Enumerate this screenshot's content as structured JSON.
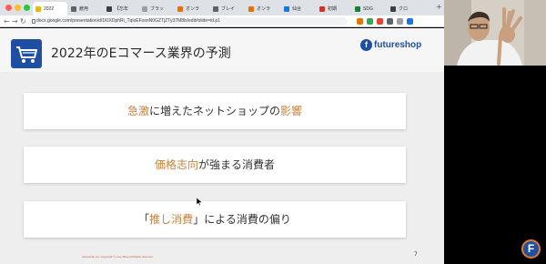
{
  "browser": {
    "tabs": [
      {
        "label": "2022",
        "favicon_color": "#f4b400",
        "active": true
      },
      {
        "label": "雇用",
        "favicon_color": "#5f6368",
        "active": false
      },
      {
        "label": "【忘年",
        "favicon_color": "#3c4043",
        "active": false
      },
      {
        "label": "ブラッ",
        "favicon_color": "#9aa0a6",
        "active": false
      },
      {
        "label": "オンラ",
        "favicon_color": "#e8710a",
        "active": false
      },
      {
        "label": "ブレイ",
        "favicon_color": "#5f6368",
        "active": false
      },
      {
        "label": "オンラ",
        "favicon_color": "#e8710a",
        "active": false
      },
      {
        "label": "仙台",
        "favicon_color": "#1a73e8",
        "active": false
      },
      {
        "label": "初期",
        "favicon_color": "#d93025",
        "active": false
      },
      {
        "label": "SDG",
        "favicon_color": "#188038",
        "active": false
      },
      {
        "label": "クロ",
        "favicon_color": "#3c4043",
        "active": false
      }
    ],
    "new_tab_symbol": "+",
    "nav": {
      "back": "←",
      "forward": "→",
      "reload": "↻"
    },
    "url": "docs.google.com/presentation/d/1KlXDphRi_TqloEFoxnN0GZTjZTy37M8ls/edit#slide=id.p1",
    "extension_colors": [
      "#e8710a",
      "#34a853",
      "#ea4335",
      "#5f6368",
      "#9aa0a6",
      "#1a73e8"
    ]
  },
  "slide": {
    "title": "2022年のEコマース業界の予測",
    "logo": {
      "mark": "f",
      "text": "futureshop"
    },
    "cards": [
      {
        "pre": "",
        "highlight": "急激",
        "post": "に増えたネットショップの",
        "highlight2": "影響",
        "post2": ""
      },
      {
        "pre": "",
        "highlight": "価格志向",
        "post": "が強まる消費者",
        "highlight2": "",
        "post2": ""
      },
      {
        "pre": "「",
        "highlight": "推し消費",
        "post": "」による消費の偏り",
        "highlight2": "",
        "post2": ""
      }
    ],
    "footer_text": "futureshop inc.    Copyright © Love Shop All Rights reserved.",
    "page_number": "7"
  },
  "overlay": {
    "corner_logo_mark": "F"
  },
  "colors": {
    "brand_blue": "#1f4fa3",
    "highlight_orange": "#c8823e",
    "footer_red": "#c05a3a"
  }
}
